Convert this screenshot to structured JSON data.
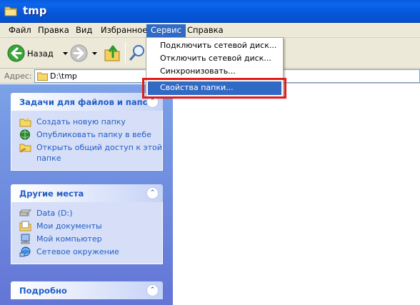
{
  "window": {
    "title": "tmp"
  },
  "menubar": {
    "items": [
      {
        "label": "Файл"
      },
      {
        "label": "Правка"
      },
      {
        "label": "Вид"
      },
      {
        "label": "Избранное"
      },
      {
        "label": "Сервис"
      },
      {
        "label": "Справка"
      }
    ],
    "active": "Сервис"
  },
  "toolbar": {
    "back_label": "Назад"
  },
  "address": {
    "label": "Адрес:",
    "value": "D:\\tmp"
  },
  "service_menu": {
    "items": [
      {
        "label": "Подключить сетевой диск..."
      },
      {
        "label": "Отключить сетевой диск..."
      },
      {
        "label": "Синхронизовать..."
      },
      {
        "label": "Свойства папки..."
      }
    ],
    "highlighted": "Свойства папки..."
  },
  "taskpane": {
    "file_tasks": {
      "title": "Задачи для файлов и папок",
      "items": [
        {
          "label": "Создать новую папку",
          "icon": "new-folder-icon"
        },
        {
          "label": "Опубликовать папку в вебе",
          "icon": "publish-web-icon"
        },
        {
          "label": "Открыть общий доступ к этой папке",
          "icon": "share-folder-icon"
        }
      ]
    },
    "other_places": {
      "title": "Другие места",
      "items": [
        {
          "label": "Data (D:)",
          "icon": "drive-icon"
        },
        {
          "label": "Мои документы",
          "icon": "my-documents-icon"
        },
        {
          "label": "Мой компьютер",
          "icon": "my-computer-icon"
        },
        {
          "label": "Сетевое окружение",
          "icon": "network-places-icon"
        }
      ]
    },
    "details": {
      "title": "Подробно"
    }
  },
  "colors": {
    "titlebar": "#0654d8",
    "menu_highlight": "#316ac5",
    "task_link": "#215dc6",
    "annotation": "#e21b1b"
  }
}
